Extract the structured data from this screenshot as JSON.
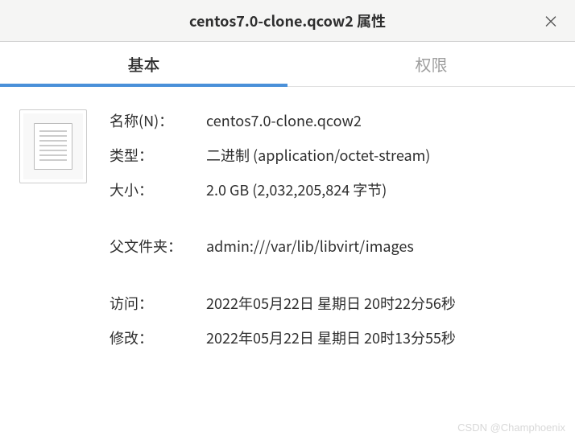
{
  "titlebar": {
    "title": "centos7.0-clone.qcow2 属性",
    "close_label": "×"
  },
  "tabs": {
    "basic": "基本",
    "permissions": "权限"
  },
  "properties": {
    "name_label": "名称(N)：",
    "name_value": "centos7.0-clone.qcow2",
    "type_label": "类型：",
    "type_value": "二进制 (application/octet-stream)",
    "size_label": "大小：",
    "size_value": "2.0 GB (2,032,205,824 字节)",
    "parent_label": "父文件夹：",
    "parent_value": "admin:///var/lib/libvirt/images",
    "accessed_label": "访问：",
    "accessed_value": "2022年05月22日 星期日 20时22分56秒",
    "modified_label": "修改：",
    "modified_value": "2022年05月22日 星期日 20时13分55秒"
  },
  "watermark": "CSDN @Champhoenix"
}
